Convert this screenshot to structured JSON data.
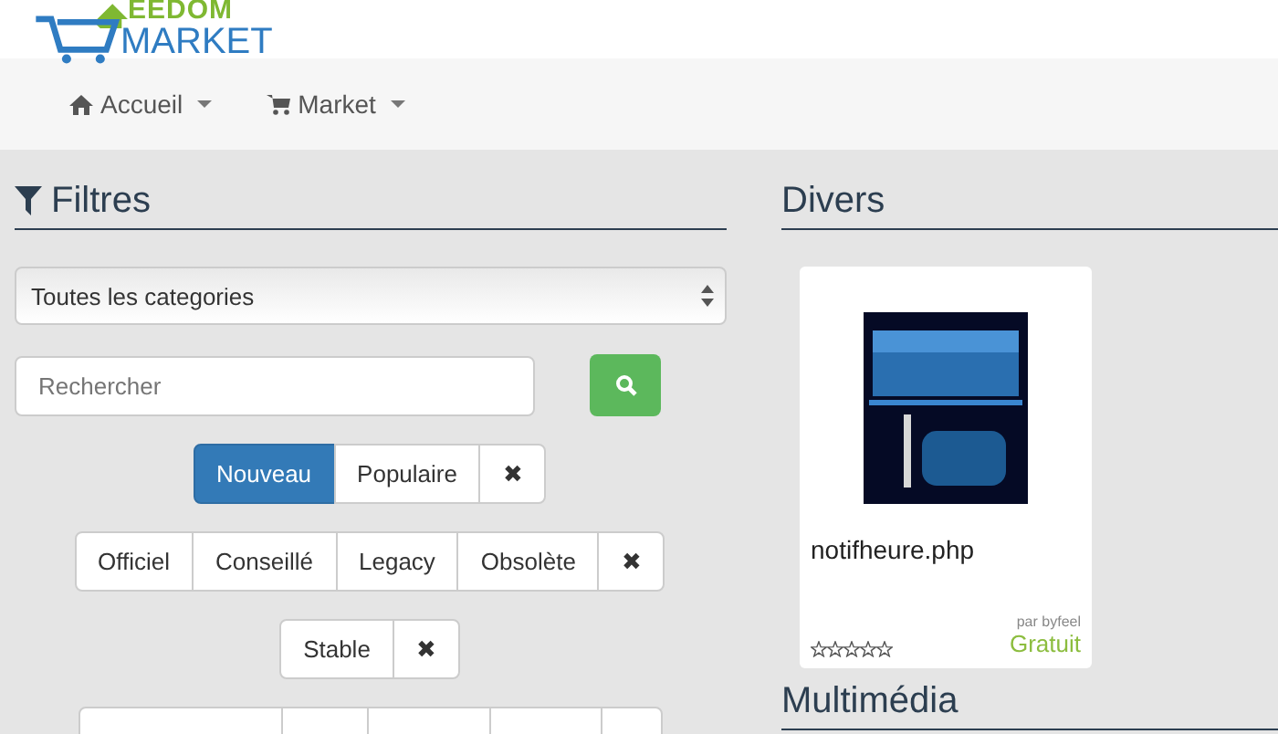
{
  "logo": {
    "top": "EEDOM",
    "bottom": "MARKET"
  },
  "nav": [
    {
      "label": "Accueil"
    },
    {
      "label": "Market"
    }
  ],
  "filters": {
    "title": "Filtres",
    "category": "Toutes les categories",
    "search": {
      "placeholder": "Rechercher"
    },
    "groups": [
      [
        {
          "label": "Nouveau",
          "selected": true
        },
        {
          "label": "Populaire",
          "selected": false
        },
        {
          "label": "✖",
          "selected": false
        }
      ],
      [
        {
          "label": "Officiel",
          "selected": false
        },
        {
          "label": "Conseillé",
          "selected": false
        },
        {
          "label": "Legacy",
          "selected": false
        },
        {
          "label": "Obsolète",
          "selected": false
        },
        {
          "label": "✖",
          "selected": false
        }
      ],
      [
        {
          "label": "Stable",
          "selected": false
        },
        {
          "label": "✖",
          "selected": false
        }
      ]
    ],
    "cut_row": [
      {
        "kind": "button"
      },
      {
        "kind": "button"
      },
      {
        "kind": "button"
      },
      {
        "kind": "button"
      },
      {
        "kind": "button"
      }
    ]
  },
  "sections": [
    {
      "title": "Divers",
      "cards": [
        {
          "kind": "picture",
          "name": "notifheure.php",
          "author": "par byfeel",
          "price": "Gratuit",
          "stars": 0
        }
      ]
    },
    {
      "title": "Multimédia"
    }
  ]
}
